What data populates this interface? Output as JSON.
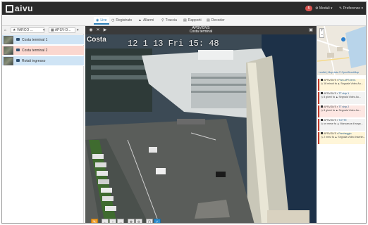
{
  "app": {
    "logo_text": "aivu"
  },
  "topbar": {
    "notification_count": "5",
    "moduli_label": "Moduli ▾",
    "preferenze_label": "Preferenze ▾"
  },
  "nav": {
    "tabs": [
      {
        "icon": "◉",
        "label": "Live",
        "active": true
      },
      {
        "icon": "◷",
        "label": "Registrato",
        "active": false
      },
      {
        "icon": "▲",
        "label": "Allarmi",
        "active": false
      },
      {
        "icon": "⚲",
        "label": "Traccia",
        "active": false
      },
      {
        "icon": "▤",
        "label": "Rapporti",
        "active": false
      },
      {
        "icon": "▤",
        "label": "Decoder",
        "active": false
      }
    ]
  },
  "left_panel": {
    "toolbar": {
      "home_icon": "⌂",
      "selector1": "VARCO ...",
      "selector2": "APSV-D...",
      "arrow": "▾"
    },
    "cameras": [
      {
        "label": "Costa terminal 1",
        "color": "#cfe4f5"
      },
      {
        "label": "Costa terminal 2",
        "color": "#fbd7cf"
      },
      {
        "label": "Rotati ingresso",
        "color": "#cfe4f5"
      }
    ]
  },
  "video": {
    "toolbar_icons": [
      "◉",
      "✕",
      "▶"
    ],
    "title": "APSV/DVS",
    "subtitle": "Costa terminal",
    "overlay_label": "Costa",
    "timestamp": "12 1 13 Fri 15: 48"
  },
  "ptz": {
    "buttons": [
      "✎",
      "←",
      "↑",
      "→",
      "⊕",
      "⊖",
      "▢",
      "✓"
    ]
  },
  "right_panel": {
    "map": {
      "credit": "Leaflet | Map data © OpenStreetMap"
    },
    "events": [
      {
        "source": "APSV/DVS",
        "label": "Park APS term.",
        "time": "18 minuti fa",
        "action": "Segnala Video Au..."
      },
      {
        "source": "APSV/DVS",
        "label": "TT ship 1",
        "time": "8 giorni fa",
        "action": "Segnala Video Au..."
      },
      {
        "source": "APSV/DVS",
        "label": "TT ship 2",
        "time": "8 giorni fa",
        "action": "Segnala Video Au..."
      },
      {
        "source": "APSV/DVS",
        "label": "TUTTE",
        "time": "un mese fa",
        "action": "Mancanza di segn..."
      },
      {
        "source": "APSV/DVS",
        "label": "Parcheggio",
        "time": "2 mesi fa",
        "action": "Segnala Video Inserim..."
      }
    ]
  },
  "colors": {
    "topbar": "#2b2b2b",
    "accent": "#2c7fb8",
    "alert": "#d9534f"
  }
}
